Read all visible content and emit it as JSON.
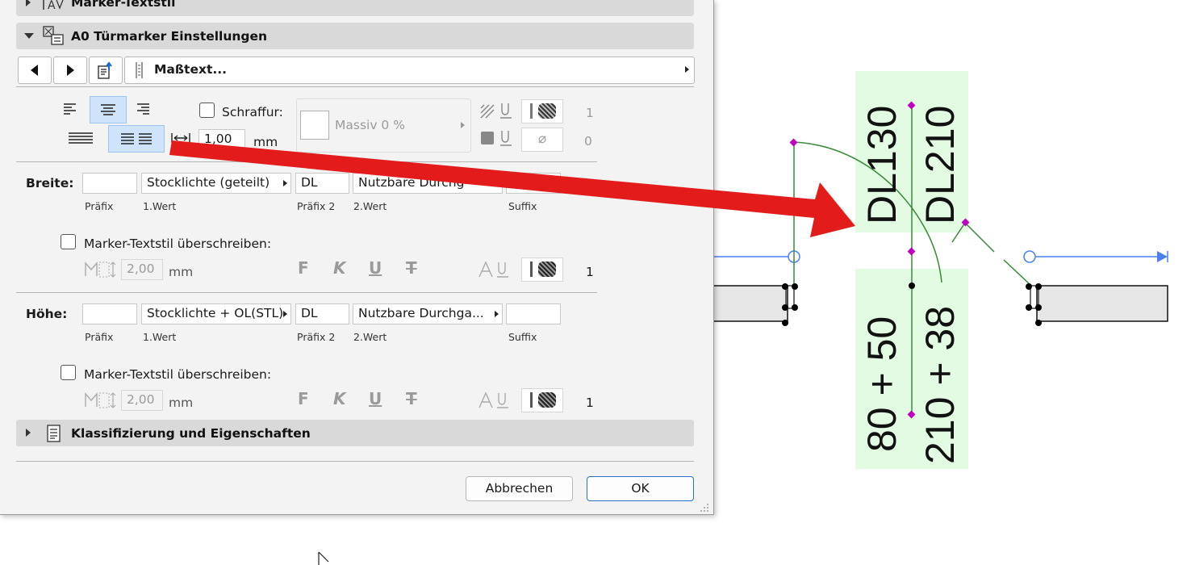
{
  "dialog": {
    "section_marker_textstyle": "Marker-Textstil",
    "section_door_marker": "A0 Türmarker Einstellungen",
    "dropdown_masstext": "Maßtext...",
    "hatch_label": "Schraffur:",
    "hatch_value": "Massiv 0 %",
    "spacing_value": "1,00",
    "unit_mm": "mm",
    "pen_number_1": "1",
    "pen_number_0": "0",
    "width": {
      "label": "Breite:",
      "prefix_value": "",
      "value1": "Stocklichte (geteilt)",
      "prefix2_value": "DL",
      "value2": "Nutzbare Durchg",
      "suffix_value": ""
    },
    "height": {
      "label": "Höhe:",
      "prefix_value": "",
      "value1": "Stocklichte + OL(STL)",
      "prefix2_value": "DL",
      "value2": "Nutzbare Durchga...",
      "suffix_value": ""
    },
    "captions": {
      "prefix": "Präfix",
      "value1": "1.Wert",
      "prefix2": "Präfix 2",
      "value2": "2.Wert",
      "suffix": "Suffix"
    },
    "override_label": "Marker-Textstil überschreiben:",
    "text_size": "2,00",
    "format_bold": "F",
    "format_italic": "K",
    "format_underline": "U",
    "format_strike": "T",
    "pen_value": "1",
    "section_classification": "Klassifizierung und Eigenschaften",
    "cancel_label": "Abbrechen",
    "ok_label": "OK"
  },
  "drawing": {
    "label_width_top": "DL130",
    "label_height_top": "DL210",
    "label_width_bottom": "80 + 50",
    "label_height_bottom": "210 + 38",
    "label_bg_color": "#e3fae3",
    "handle_color": "#c000c0",
    "dimension_line_color": "#4a80ee",
    "door_swing_color": "#3a8a3a"
  },
  "annotation": {
    "arrow_color": "#e31b1b"
  },
  "icons": [
    "marker-textstyle-icon",
    "door-marker-settings-icon",
    "prev-arrow-icon",
    "next-arrow-icon",
    "export-settings-icon",
    "dimension-text-icon",
    "align-left-icon",
    "align-center-icon",
    "align-right-icon",
    "justify-icon",
    "justify-center-icon",
    "text-spacing-icon",
    "hatch-pattern-icon",
    "fill-pen-icon",
    "classification-icon",
    "text-frame-icon",
    "font-pen-icon",
    "resize-grip-icon",
    "mouse-cursor-icon"
  ]
}
